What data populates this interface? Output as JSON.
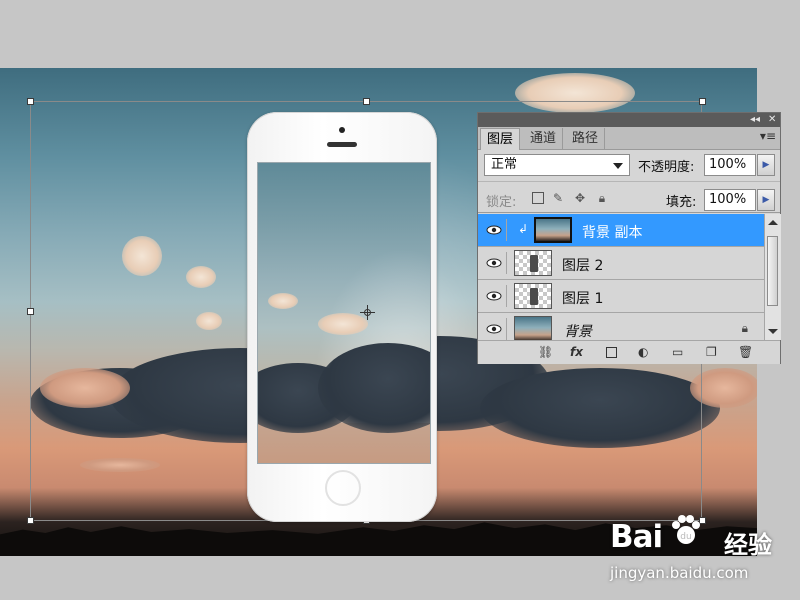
{
  "layers_panel": {
    "tabs": [
      {
        "label": "图层",
        "active": true
      },
      {
        "label": "通道",
        "active": false
      },
      {
        "label": "路径",
        "active": false
      }
    ],
    "blend_mode": "正常",
    "opacity_label": "不透明度:",
    "opacity_value": "100%",
    "lock_label": "锁定:",
    "fill_label": "填充:",
    "fill_value": "100%",
    "layers": [
      {
        "name": "背景 副本",
        "selected": true,
        "thumbnail": "photo",
        "clipped": true
      },
      {
        "name": "图层 2",
        "selected": false,
        "thumbnail": "phone-outline"
      },
      {
        "name": "图层 1",
        "selected": false,
        "thumbnail": "phone-outline"
      },
      {
        "name": "背景",
        "selected": false,
        "thumbnail": "photo",
        "locked": true,
        "italic": true
      }
    ],
    "top_bar_buttons": [
      "collapse-icon",
      "close-icon"
    ],
    "footer_icons": [
      "link-icon",
      "fx-icon",
      "mask-icon",
      "adjustment-icon",
      "folder-icon",
      "new-layer-icon",
      "trash-icon"
    ]
  },
  "watermark": {
    "logo_text": "Bai",
    "logo_text_suffix": "经验",
    "url": "jingyan.baidu.com"
  },
  "colors": {
    "selection": "#3399ff",
    "panel_bg": "#d6d6d6",
    "workspace_bg": "#c6c6c6"
  }
}
